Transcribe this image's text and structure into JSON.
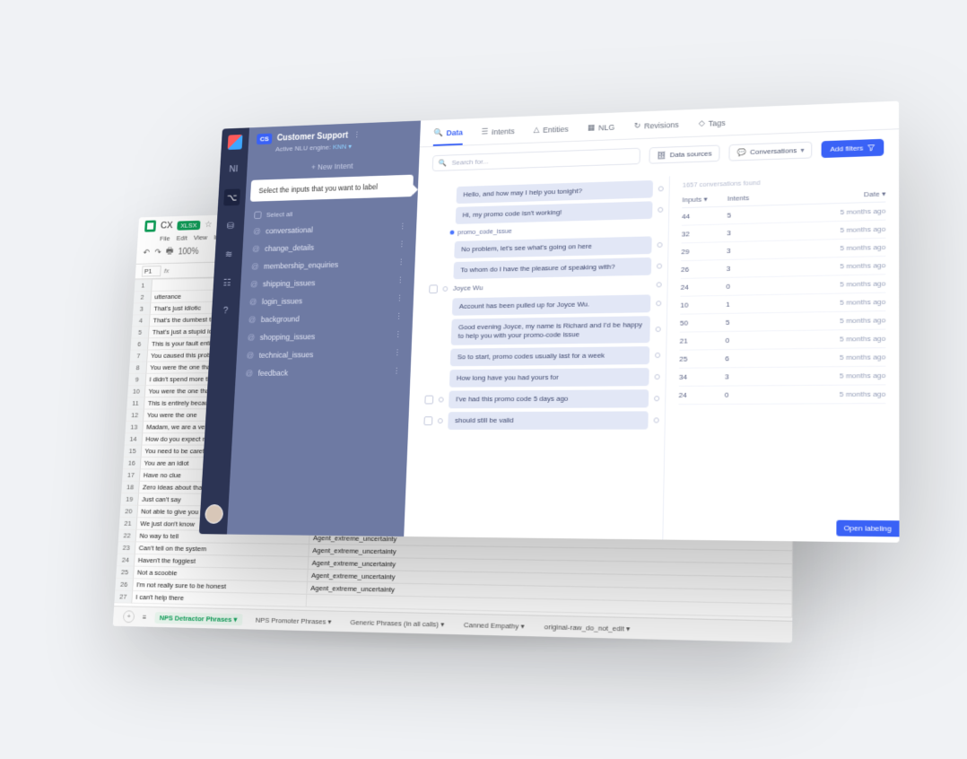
{
  "sheet": {
    "docTitle": "CX",
    "badge": "XLSX",
    "menus": [
      "File",
      "Edit",
      "View",
      "In"
    ],
    "zoom": "100%",
    "cellRef": "P1",
    "rowHeader": "utterance",
    "rows": [
      "That's just idiotic",
      "That's the dumbest thing",
      "That's just a stupid idea",
      "This is your fault entirely",
      "You caused this problem",
      "You were the one that's",
      "I didn't spend more that I",
      "You were the one that was",
      "This is entirely because of",
      "You were the one",
      "Madam, we are a very large",
      "How do you expect me to",
      "You need to be careful with",
      "You are an idiot",
      "Have no clue",
      "Zero ideas about that",
      "Just can't say",
      "Not able to give you the answer",
      "We just don't know",
      "No way to tell",
      "Can't tell on the system",
      "Haven't the foggiest",
      "Not a scoobie",
      "I'm not really sure to be honest",
      "I can't help there"
    ],
    "colB_label": "Agent_extreme_uncertainty",
    "colB_repeat": 5,
    "tabs": [
      {
        "label": "NPS Detractor Phrases",
        "active": true
      },
      {
        "label": "NPS Promoter Phrases",
        "active": false
      },
      {
        "label": "Generic Phrases (in all calls)",
        "active": false
      },
      {
        "label": "Canned Empathy",
        "active": false
      },
      {
        "label": "original-raw_do_not_edit",
        "active": false
      }
    ]
  },
  "app": {
    "sidebar": {
      "label0": "NI"
    },
    "project": {
      "badge": "CS",
      "title": "Customer Support",
      "subLabel": "Active NLU engine:",
      "subValue": "KNN"
    },
    "newIntent": "+  New Intent",
    "tooltip": "Select the inputs that you want to label",
    "selectAll": "Select all",
    "intents": [
      "conversational",
      "change_details",
      "membership_enquiries",
      "shipping_issues",
      "login_issues",
      "background",
      "shopping_issues",
      "technical_issues",
      "feedback"
    ],
    "topTabs": [
      "Data",
      "Intents",
      "Entities",
      "NLG",
      "Revisions",
      "Tags"
    ],
    "search": {
      "placeholder": "Search for..."
    },
    "controls": {
      "dataSources": "Data sources",
      "conversations": "Conversations",
      "addFilters": "Add filters"
    },
    "bubbles": [
      {
        "kind": "bubble",
        "text": "Hello, and how may I help you tonight?",
        "check": false
      },
      {
        "kind": "bubble",
        "text": "Hi, my promo code isn't working!",
        "check": false
      },
      {
        "kind": "tag",
        "text": "promo_code_issue"
      },
      {
        "kind": "bubble",
        "text": "No problem, let's see what's going on here",
        "check": false
      },
      {
        "kind": "bubble",
        "text": "To whom do I have the pleasure of speaking with?",
        "check": false
      },
      {
        "kind": "plain",
        "text": "Joyce Wu",
        "check": true
      },
      {
        "kind": "bubble",
        "text": "Account has been pulled up for Joyce Wu.",
        "check": false
      },
      {
        "kind": "bubble",
        "text": "Good evening Joyce, my name is Richard and I'd be happy to help you with your promo-code issue",
        "check": false
      },
      {
        "kind": "bubble",
        "text": "So to start, promo codes usually last for a week",
        "check": false
      },
      {
        "kind": "bubble",
        "text": "How long have you had yours for",
        "check": false
      },
      {
        "kind": "bubble",
        "text": "I've had this promo code 5 days ago",
        "check": true
      },
      {
        "kind": "bubble",
        "text": "should still be valid",
        "check": true
      }
    ],
    "rightHint": "1657 conversations found",
    "tableHead": {
      "inputs": "Inputs",
      "intents": "Intents",
      "date": "Date"
    },
    "tableRows": [
      {
        "inputs": "44",
        "intents": "5",
        "date": "5 months ago"
      },
      {
        "inputs": "32",
        "intents": "3",
        "date": "5 months ago"
      },
      {
        "inputs": "29",
        "intents": "3",
        "date": "5 months ago"
      },
      {
        "inputs": "26",
        "intents": "3",
        "date": "5 months ago"
      },
      {
        "inputs": "24",
        "intents": "0",
        "date": "5 months ago"
      },
      {
        "inputs": "10",
        "intents": "1",
        "date": "5 months ago"
      },
      {
        "inputs": "50",
        "intents": "5",
        "date": "5 months ago"
      },
      {
        "inputs": "21",
        "intents": "0",
        "date": "5 months ago"
      },
      {
        "inputs": "25",
        "intents": "6",
        "date": "5 months ago"
      },
      {
        "inputs": "34",
        "intents": "3",
        "date": "5 months ago"
      },
      {
        "inputs": "24",
        "intents": "0",
        "date": "5 months ago"
      }
    ],
    "openLabeling": "Open labeling"
  }
}
